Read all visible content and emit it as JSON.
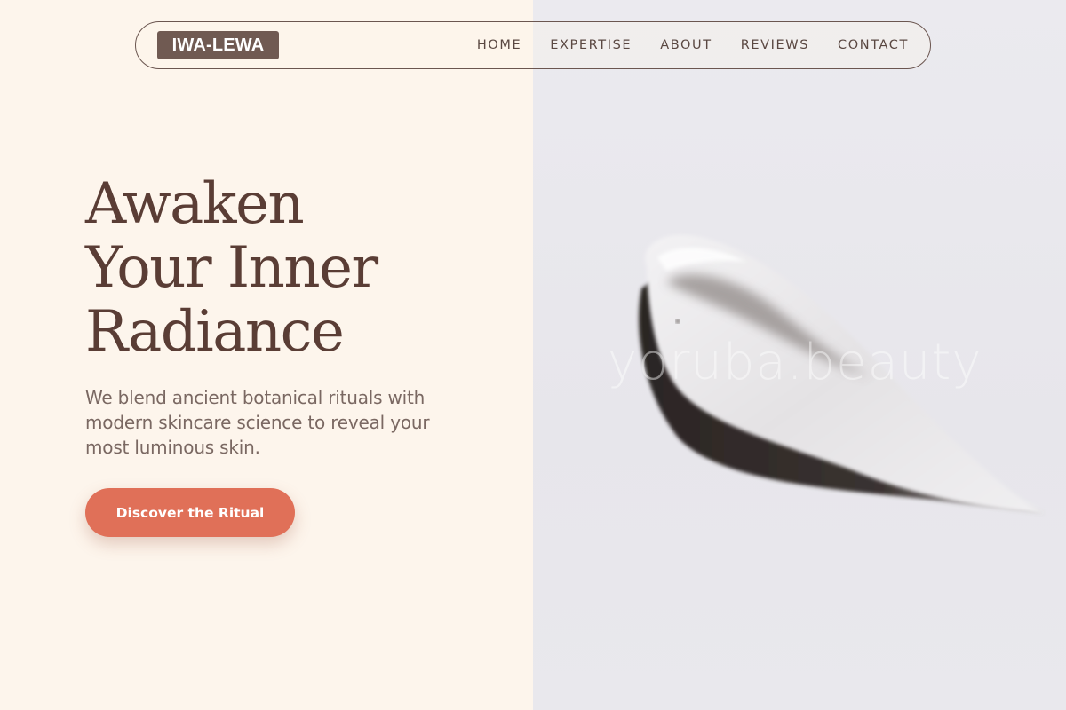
{
  "brand": {
    "logo_text": "IWA-LEWA"
  },
  "nav": {
    "items": [
      {
        "label": "HOME"
      },
      {
        "label": "EXPERTISE"
      },
      {
        "label": "ABOUT"
      },
      {
        "label": "REVIEWS"
      },
      {
        "label": "CONTACT"
      }
    ]
  },
  "hero": {
    "headline_lines": [
      "Awaken",
      "Your Inner",
      "Radiance"
    ],
    "subtext": "We blend ancient botanical rituals with modern skincare science to reveal your most luminous skin.",
    "cta_label": "Discover the Ritual"
  },
  "image": {
    "watermark": "yoruba.beauty"
  },
  "colors": {
    "cream_background": "#fdf5ec",
    "image_background": "#e9e8ed",
    "brand_brown": "#705a52",
    "headline_brown": "#5a3d35",
    "cta_coral": "#e07058"
  }
}
